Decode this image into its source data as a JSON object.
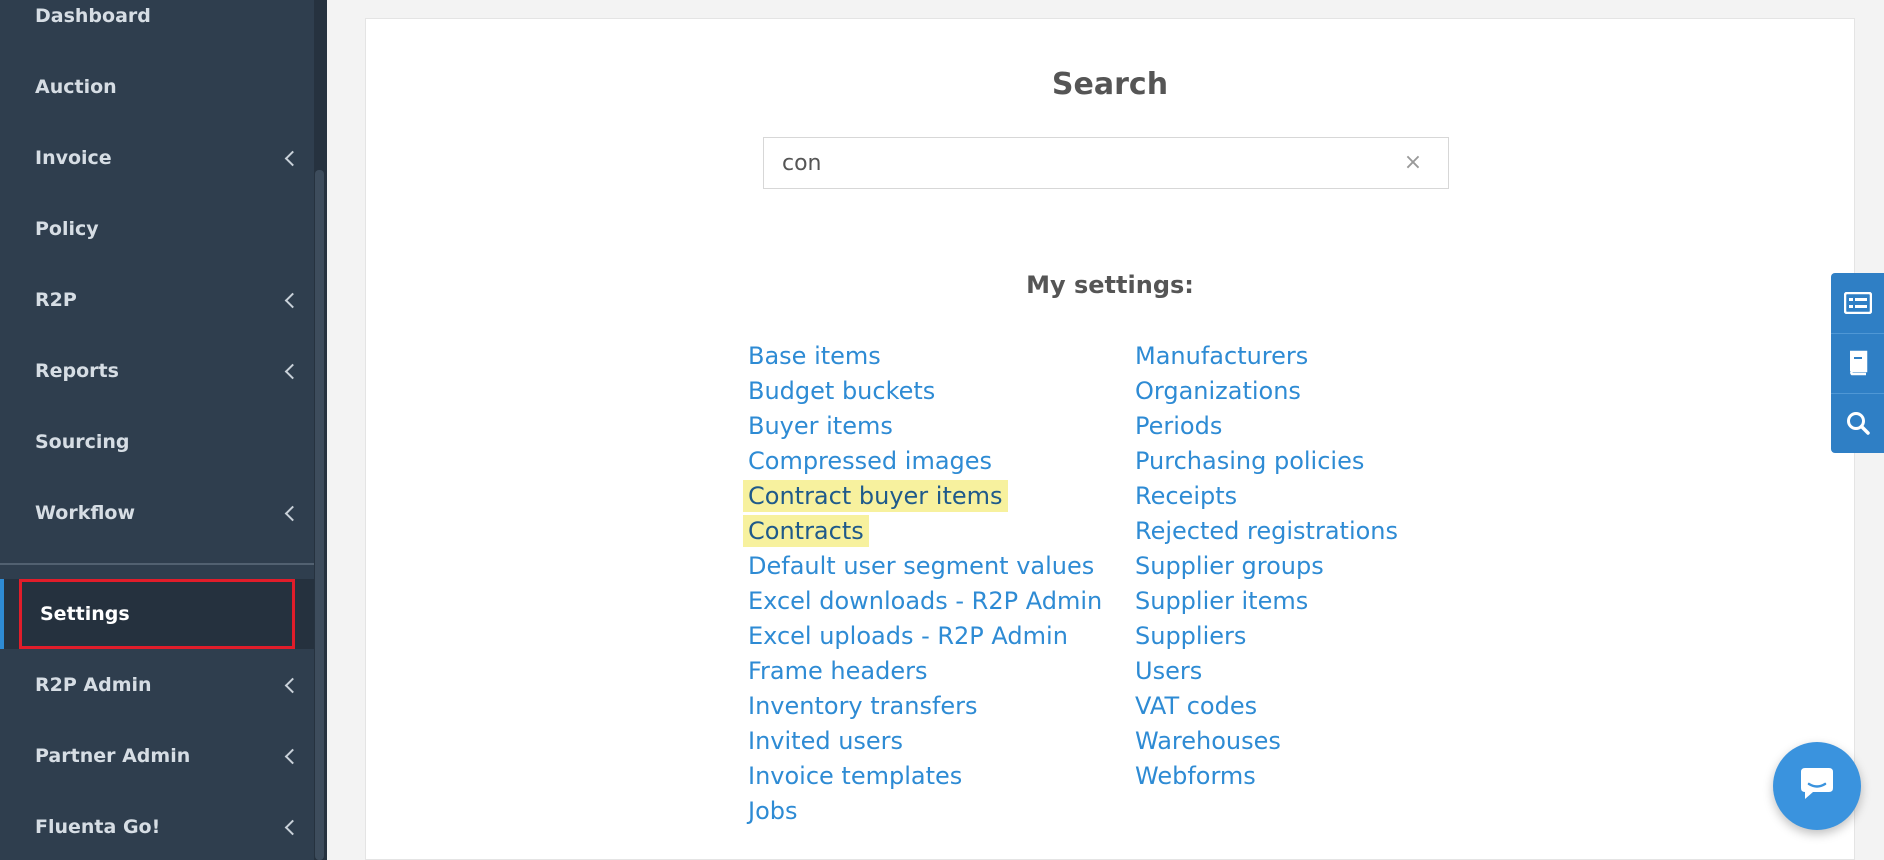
{
  "sidebar": {
    "items": [
      {
        "label": "Dashboard",
        "has_children": false
      },
      {
        "label": "Auction",
        "has_children": false
      },
      {
        "label": "Invoice",
        "has_children": true
      },
      {
        "label": "Policy",
        "has_children": false
      },
      {
        "label": "R2P",
        "has_children": true
      },
      {
        "label": "Reports",
        "has_children": true
      },
      {
        "label": "Sourcing",
        "has_children": false
      },
      {
        "label": "Workflow",
        "has_children": true
      }
    ],
    "settings": {
      "label": "Settings",
      "active": true
    },
    "admin_items": [
      {
        "label": "R2P Admin",
        "has_children": true
      },
      {
        "label": "Partner Admin",
        "has_children": true
      },
      {
        "label": "Fluenta Go!",
        "has_children": true
      }
    ]
  },
  "main": {
    "title": "Search",
    "search": {
      "value": "con",
      "placeholder": ""
    },
    "clear_icon": "×",
    "section_heading": "My settings:",
    "left_links": [
      "Base items",
      "Budget buckets",
      "Buyer items",
      "Compressed images",
      "Contract buyer items",
      "Contracts",
      "Default user segment values",
      "Excel downloads - R2P Admin",
      "Excel uploads - R2P Admin",
      "Frame headers",
      "Inventory transfers",
      "Invited users",
      "Invoice templates",
      "Jobs"
    ],
    "right_links": [
      "Manufacturers",
      "Organizations",
      "Periods",
      "Purchasing policies",
      "Receipts",
      "Rejected registrations",
      "Supplier groups",
      "Supplier items",
      "Suppliers",
      "Users",
      "VAT codes",
      "Warehouses",
      "Webforms"
    ],
    "highlighted_links": [
      "Contract buyer items",
      "Contracts"
    ]
  },
  "floating_tabs": [
    "list-icon",
    "book-icon",
    "search-icon"
  ],
  "chat": {
    "icon": "chat-icon"
  },
  "colors": {
    "sidebar_bg": "#2f3e4e",
    "accent": "#2e8bd4",
    "highlight": "#f7f19e",
    "active_outline": "#e11d2a"
  }
}
